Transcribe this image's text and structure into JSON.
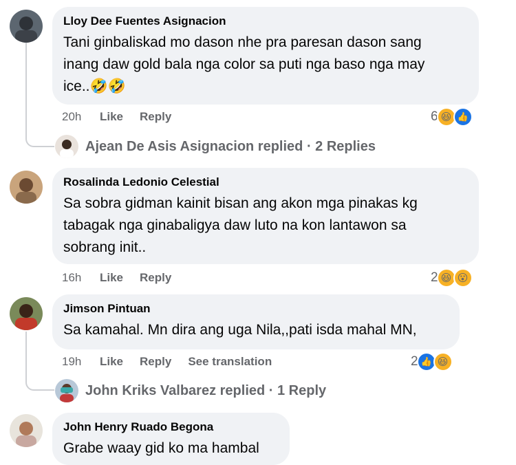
{
  "comments": [
    {
      "name": "Lloy Dee Fuentes Asignacion",
      "lines": [
        "Tani ginbaliskad mo dason nhe pra paresan dason sang",
        "inang daw gold bala nga color sa puti nga baso nga may",
        "ice..🤣🤣"
      ],
      "time": "20h",
      "like_label": "Like",
      "reply_label": "Reply",
      "reaction_count": "6",
      "reactions": [
        "haha",
        "like"
      ],
      "replies_text": "Ajean De Asis Asignacion replied · 2 Replies"
    },
    {
      "name": "Rosalinda Ledonio Celestial",
      "lines": [
        "Sa sobra gidman kainit bisan ang akon mga pinakas kg",
        "tabagak nga ginabaligya daw luto na kon lantawon sa",
        "sobrang init.."
      ],
      "time": "16h",
      "like_label": "Like",
      "reply_label": "Reply",
      "reaction_count": "2",
      "reactions": [
        "haha",
        "wow"
      ]
    },
    {
      "name": "Jimson Pintuan",
      "lines": [
        "Sa kamahal. Mn dira ang uga Nila,,pati isda mahal MN,"
      ],
      "time": "19h",
      "like_label": "Like",
      "reply_label": "Reply",
      "translate_label": "See translation",
      "reaction_count": "2",
      "reactions": [
        "like",
        "haha"
      ],
      "replies_text": "John Kriks Valbarez replied · 1 Reply"
    },
    {
      "name": "John Henry Ruado Begona",
      "lines": [
        "Grabe waay gid ko ma hambal"
      ]
    }
  ],
  "colors": {
    "bubble": "#f0f2f5",
    "meta_text": "#65676b",
    "like_blue": "#1b74e4",
    "haha_yellow": "#f7b125"
  },
  "icons": {
    "haha": "laughing-face-icon",
    "like": "thumbs-up-icon",
    "wow": "surprised-face-icon"
  }
}
